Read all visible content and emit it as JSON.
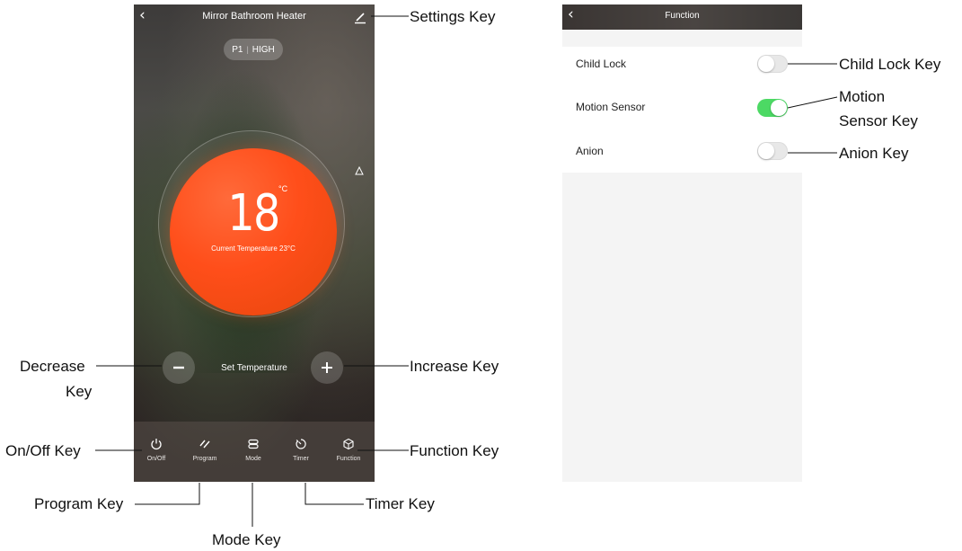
{
  "left_screen": {
    "title": "Mirror Bathroom Heater",
    "mode_program": "P1",
    "mode_separator": "|",
    "mode_level": "HIGH",
    "temperature": "18",
    "temperature_unit": "°C",
    "current_temperature": "Current Temperature 23°C",
    "set_temperature_label": "Set Temperature",
    "tabs": [
      {
        "label": "On/Off",
        "icon": "power-icon"
      },
      {
        "label": "Program",
        "icon": "program-icon"
      },
      {
        "label": "Mode",
        "icon": "mode-icon"
      },
      {
        "label": "Timer",
        "icon": "timer-icon"
      },
      {
        "label": "Function",
        "icon": "function-icon"
      }
    ]
  },
  "right_screen": {
    "title": "Function",
    "settings": [
      {
        "label": "Child Lock",
        "on": false
      },
      {
        "label": "Motion Sensor",
        "on": true
      },
      {
        "label": "Anion",
        "on": false
      }
    ]
  },
  "callouts": {
    "settings_key": "Settings Key",
    "decrease_key_line1": "Decrease",
    "decrease_key_line2": "Key",
    "increase_key": "Increase Key",
    "onoff_key": "On/Off Key",
    "function_key": "Function Key",
    "program_key": "Program Key",
    "timer_key": "Timer Key",
    "mode_key": "Mode Key",
    "child_lock_key": "Child Lock Key",
    "motion_sensor_key_line1": "Motion",
    "motion_sensor_key_line2": "Sensor Key",
    "anion_key": "Anion Key"
  },
  "colors": {
    "dial_orange": "#f14a12",
    "toggle_on": "#4cd964",
    "toggle_off": "#e8e8e8"
  }
}
